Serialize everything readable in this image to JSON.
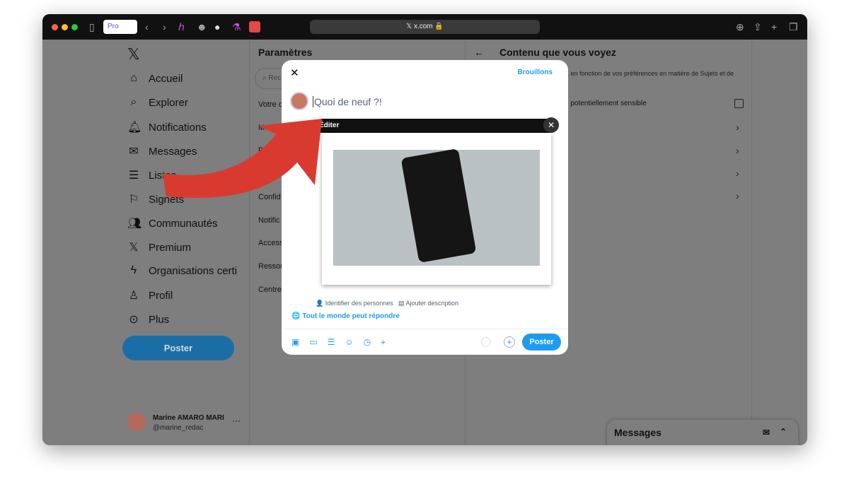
{
  "browser": {
    "url": "x.com",
    "profile": "Pro"
  },
  "nav": {
    "items": [
      {
        "label": "Accueil",
        "icon": "home-icon"
      },
      {
        "label": "Explorer",
        "icon": "search-icon"
      },
      {
        "label": "Notifications",
        "icon": "bell-icon"
      },
      {
        "label": "Messages",
        "icon": "mail-icon"
      },
      {
        "label": "Listes",
        "icon": "list-icon"
      },
      {
        "label": "Signets",
        "icon": "bookmark-icon"
      },
      {
        "label": "Communautés",
        "icon": "people-icon"
      },
      {
        "label": "Premium",
        "icon": "x-icon"
      },
      {
        "label": "Organisations certi",
        "icon": "bolt-icon"
      },
      {
        "label": "Profil",
        "icon": "person-icon"
      },
      {
        "label": "Plus",
        "icon": "more-icon"
      }
    ],
    "post": "Poster",
    "user": {
      "name": "Marine AMARO MARI",
      "handle": "@marine_redac"
    }
  },
  "settings": {
    "title": "Paramètres",
    "search_placeholder": "Rec",
    "items": [
      "Votre c",
      "M",
      "Pr",
      "Sécurit",
      "Confid",
      "Notific",
      "Access",
      "Ressou",
      "Centre"
    ]
  },
  "right": {
    "title": "Contenu que vous voyez",
    "desc": "X en fonction de vos préférences en matière de Sujets et de",
    "sensitive": "u potentiellement sensible"
  },
  "messages": {
    "title": "Messages"
  },
  "composer": {
    "drafts": "Brouillons",
    "placeholder": "Quoi de neuf ?!",
    "edit": "Éditer",
    "tag": "Identifier des personnes",
    "describe": "Ajouter description",
    "reply": "Tout le monde peut répondre",
    "post": "Poster"
  }
}
